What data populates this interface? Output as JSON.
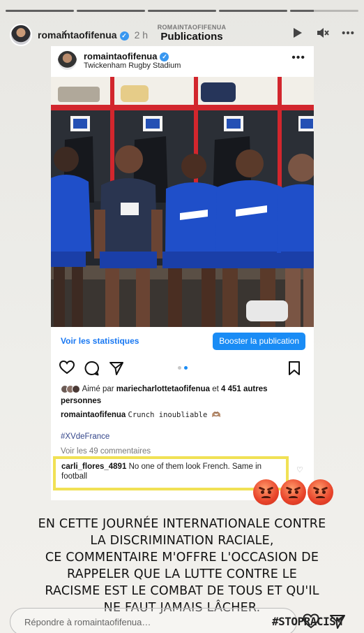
{
  "story": {
    "username": "romaintaofifenua",
    "time": "2 h",
    "progress_bars": [
      1.0,
      1.0,
      1.0,
      1.0,
      0.35
    ]
  },
  "header": {
    "subtitle": "ROMAINTAOFIFENUA",
    "title": "Publications",
    "back_icon": "chevron-left-icon"
  },
  "post": {
    "username": "romaintaofifenua",
    "location": "Twickenham Rugby Stadium",
    "stats_link": "Voir les statistiques",
    "boost_button": "Booster la publication",
    "carousel_active_index": 1,
    "liked_by_prefix": "Aimé par",
    "liked_by_user": "mariecharlottetaofifenua",
    "liked_by_connector": "et",
    "liked_by_others": "4 451 autres personnes",
    "caption_user": "romaintaofifenua",
    "caption_text": "Crunch inoubliable 🫶🏽",
    "hashtag": "#XVdeFrance",
    "view_comments": "Voir les 49 commentaires",
    "comment_user": "carli_flores_4891",
    "comment_text": "No one of them look French. Same in football"
  },
  "message": {
    "lines": [
      "EN CETTE JOURNÉE INTERNATIONALE CONTRE",
      "LA DISCRIMINATION RACIALE,",
      "CE COMMENTAIRE M'OFFRE L'OCCASION DE",
      "RAPPELER QUE LA LUTTE CONTRE LE",
      "RACISME EST LE COMBAT DE TOUS ET QU'IL",
      "NE FAUT JAMAIS LÂCHER."
    ]
  },
  "reply": {
    "placeholder": "Répondre à romaintaofifenua…",
    "hashtag_sticker": "#STOPRACISM"
  },
  "colors": {
    "highlight_border": "#f1e155",
    "link_blue": "#1877f2",
    "boost_blue": "#1a8cf5",
    "jersey_blue": "#1f4fc9"
  }
}
